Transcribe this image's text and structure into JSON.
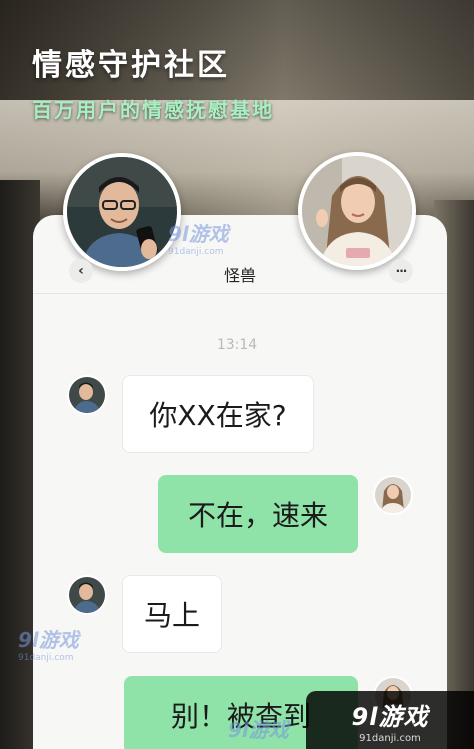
{
  "promo": {
    "headline": "情感守护社区",
    "subline": "百万用户的情感抚慰基地"
  },
  "chat": {
    "title": "怪兽",
    "back_icon": "‹",
    "more_icon": "···",
    "timestamp": "13:14",
    "messages": [
      {
        "side": "in",
        "text": "你XX在家?"
      },
      {
        "side": "out",
        "text": "不在，速来"
      },
      {
        "side": "in",
        "text": "马上"
      },
      {
        "side": "out",
        "text": "别！被查到"
      }
    ]
  },
  "watermarks": {
    "main": "9l游戏",
    "sub": "91danji.com"
  },
  "brand": {
    "name": "9l游戏",
    "url": "91danji.com"
  },
  "colors": {
    "accent_green": "#8fe2a8",
    "subline_green": "#a8f0c2",
    "card_bg": "#f7f7f5"
  }
}
